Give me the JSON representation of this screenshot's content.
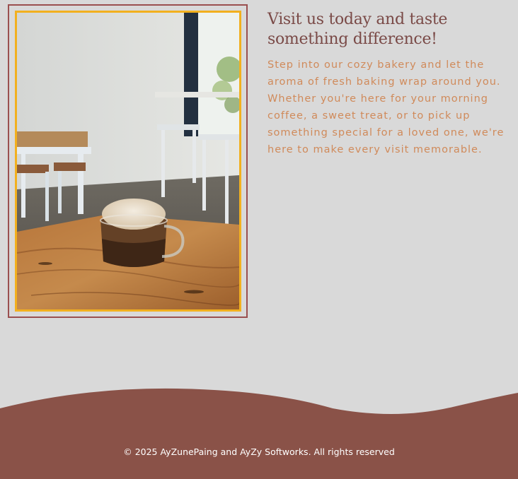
{
  "intro": {
    "heading": "Visit us today and taste something difference!",
    "body": "Step into our cozy bakery and let the aroma of fresh baking wrap around you. Whether you're here for your morning coffee, a sweet treat, or to pick up something special for a loved one, we're here to make every visit memorable."
  },
  "footer": {
    "copyright": "© 2025 AyZunePaing and AyZy Softworks. All rights reserved"
  },
  "colors": {
    "page_background": "#d9d9d9",
    "heading": "#7a4a47",
    "body_text": "#d08a5a",
    "footer_background": "#8a5248",
    "photo_outer_border": "#9a4f4f",
    "photo_inner_border": "#f2b01e"
  }
}
